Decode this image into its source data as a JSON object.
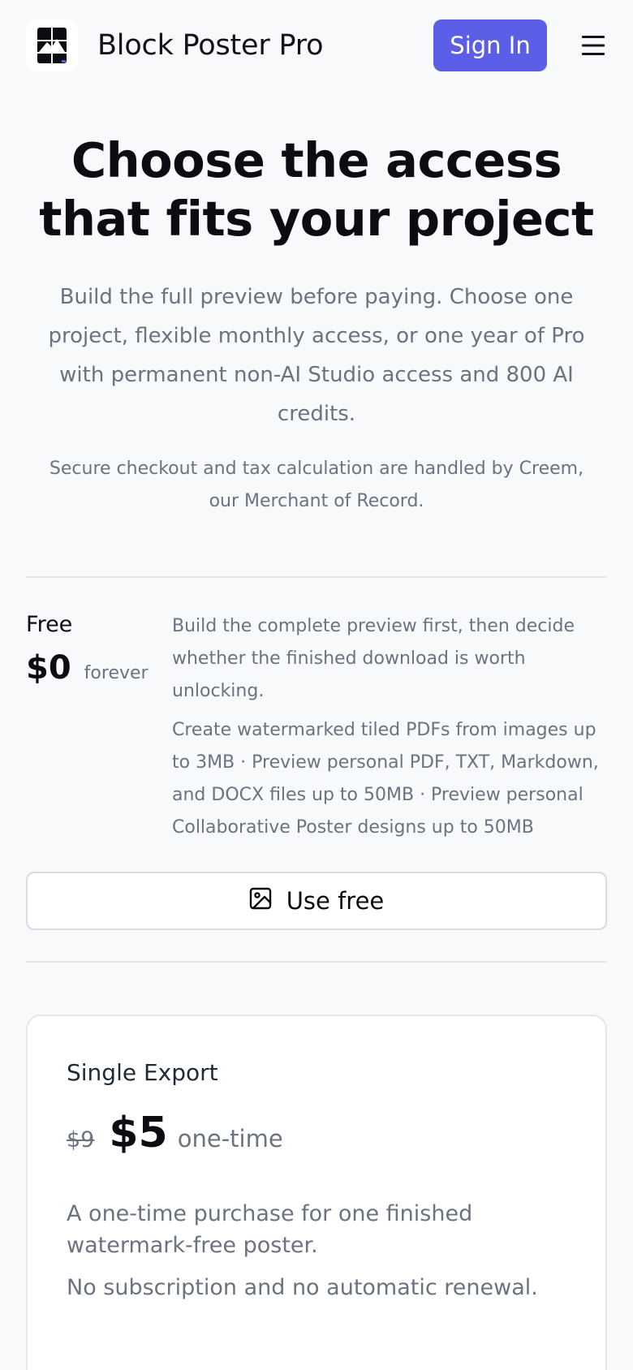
{
  "header": {
    "brand": "Block Poster Pro",
    "sign_in_label": "Sign In",
    "logo_icon": "poster-grid-logo-icon",
    "menu_icon": "hamburger-menu-icon"
  },
  "hero": {
    "title": "Choose the access that fits your project",
    "subtitle": "Build the full preview before paying. Choose one project, flexible monthly access, or one year of Pro with permanent non-AI Studio access and 800 AI credits.",
    "note": "Secure checkout and tax calculation are handled by Creem, our Merchant of Record."
  },
  "free_plan": {
    "name": "Free",
    "price": "$0",
    "period": "forever",
    "description": "Build the complete preview first, then decide whether the finished download is worth unlocking.",
    "features": "Create watermarked tiled PDFs from images up to 3MB · Preview personal PDF, TXT, Markdown, and DOCX files up to 50MB · Preview personal Collaborative Poster designs up to 50MB",
    "button_label": "Use free",
    "button_icon": "image-icon"
  },
  "single_export": {
    "name": "Single Export",
    "old_price": "$9",
    "price": "$5",
    "period": "one-time",
    "description": "A one-time purchase for one finished watermark-free poster.",
    "description2": "No subscription and no automatic renewal."
  },
  "colors": {
    "accent": "#5b5fe8",
    "background": "#f8f9fb",
    "muted_text": "#6b7280",
    "divider": "#e5e7eb"
  }
}
